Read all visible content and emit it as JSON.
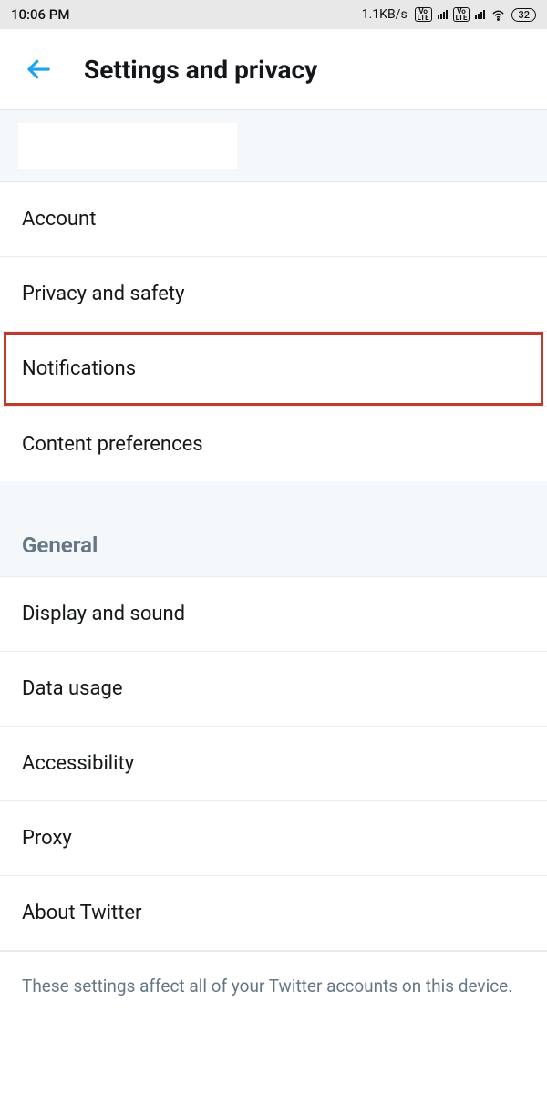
{
  "status": {
    "time": "10:06 PM",
    "speed": "1.1KB/s",
    "battery": "32"
  },
  "header": {
    "title": "Settings and privacy"
  },
  "main_items": [
    {
      "label": "Account"
    },
    {
      "label": "Privacy and safety"
    },
    {
      "label": "Notifications"
    },
    {
      "label": "Content preferences"
    }
  ],
  "general": {
    "header": "General",
    "items": [
      {
        "label": "Display and sound"
      },
      {
        "label": "Data usage"
      },
      {
        "label": "Accessibility"
      },
      {
        "label": "Proxy"
      },
      {
        "label": "About Twitter"
      }
    ]
  },
  "footer_note": "These settings affect all of your Twitter accounts on this device."
}
